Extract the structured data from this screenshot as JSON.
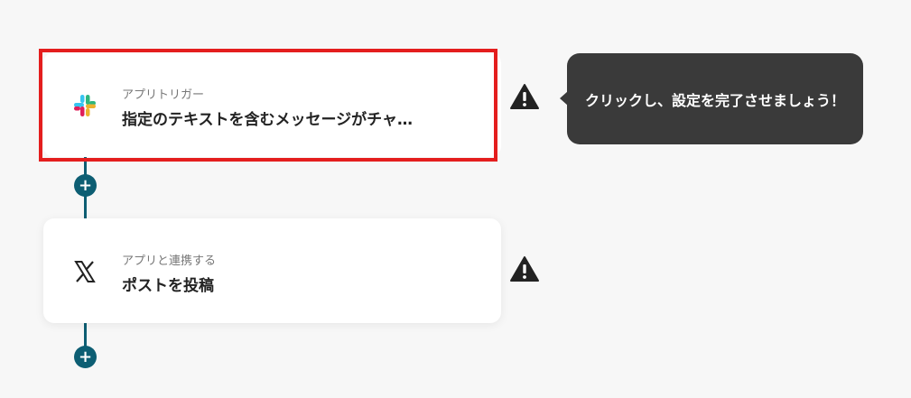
{
  "flow": {
    "steps": [
      {
        "type_label": "アプリトリガー",
        "title": "指定のテキストを含むメッセージがチャ…",
        "app_icon": "slack-icon",
        "status_icon": "warning-icon"
      },
      {
        "type_label": "アプリと連携する",
        "title": "ポストを投稿",
        "app_icon": "x-logo-icon",
        "status_icon": "warning-icon"
      }
    ],
    "add_step_label": "+"
  },
  "tooltip": {
    "text": "クリックし、設定を完了させましょう！"
  },
  "colors": {
    "connector": "#0d5e73",
    "highlight": "#e41e1e",
    "tooltip_bg": "#3a3a3a",
    "warning": "#222222"
  }
}
